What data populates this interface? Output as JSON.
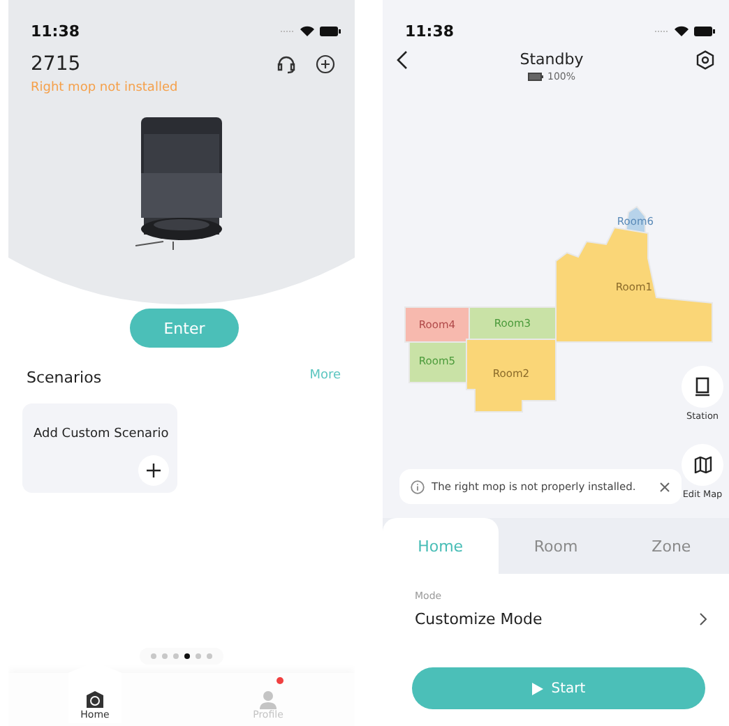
{
  "home_screen": {
    "status_bar": {
      "time": "11:38"
    },
    "device": {
      "name": "2715",
      "warning": "Right mop not installed"
    },
    "enter_button": "Enter",
    "scenarios": {
      "title": "Scenarios",
      "more": "More",
      "cards": [
        {
          "label": "Add Custom Scenario"
        }
      ]
    },
    "page_dots": [
      {
        "selected": false
      },
      {
        "selected": false
      },
      {
        "selected": false
      },
      {
        "selected": true
      },
      {
        "selected": false
      },
      {
        "selected": false
      }
    ],
    "nav": [
      {
        "label": "Home",
        "selected": true,
        "badge": false
      },
      {
        "label": "Profile",
        "selected": false,
        "badge": true
      }
    ]
  },
  "device_screen": {
    "status_bar": {
      "time": "11:38"
    },
    "header": {
      "title": "Standby",
      "battery": "100%"
    },
    "map": {
      "rooms": [
        {
          "name": "Room6",
          "color": "#b7d3ea"
        },
        {
          "name": "Room1",
          "color": "#fad677"
        },
        {
          "name": "Room4",
          "color": "#f7b9ae"
        },
        {
          "name": "Room3",
          "color": "#c9e2a6"
        },
        {
          "name": "Room5",
          "color": "#c9e2a6"
        },
        {
          "name": "Room2",
          "color": "#fad677"
        }
      ]
    },
    "side_buttons": [
      {
        "label": "Station",
        "kind": "station"
      },
      {
        "label": "Edit Map",
        "kind": "map"
      }
    ],
    "notice": "The right mop is not properly installed.",
    "tabs": [
      {
        "label": "Home",
        "selected": true
      },
      {
        "label": "Room",
        "selected": false
      },
      {
        "label": "Zone",
        "selected": false
      }
    ],
    "mode": {
      "label": "Mode",
      "value": "Customize Mode"
    },
    "start_button": "Start"
  }
}
